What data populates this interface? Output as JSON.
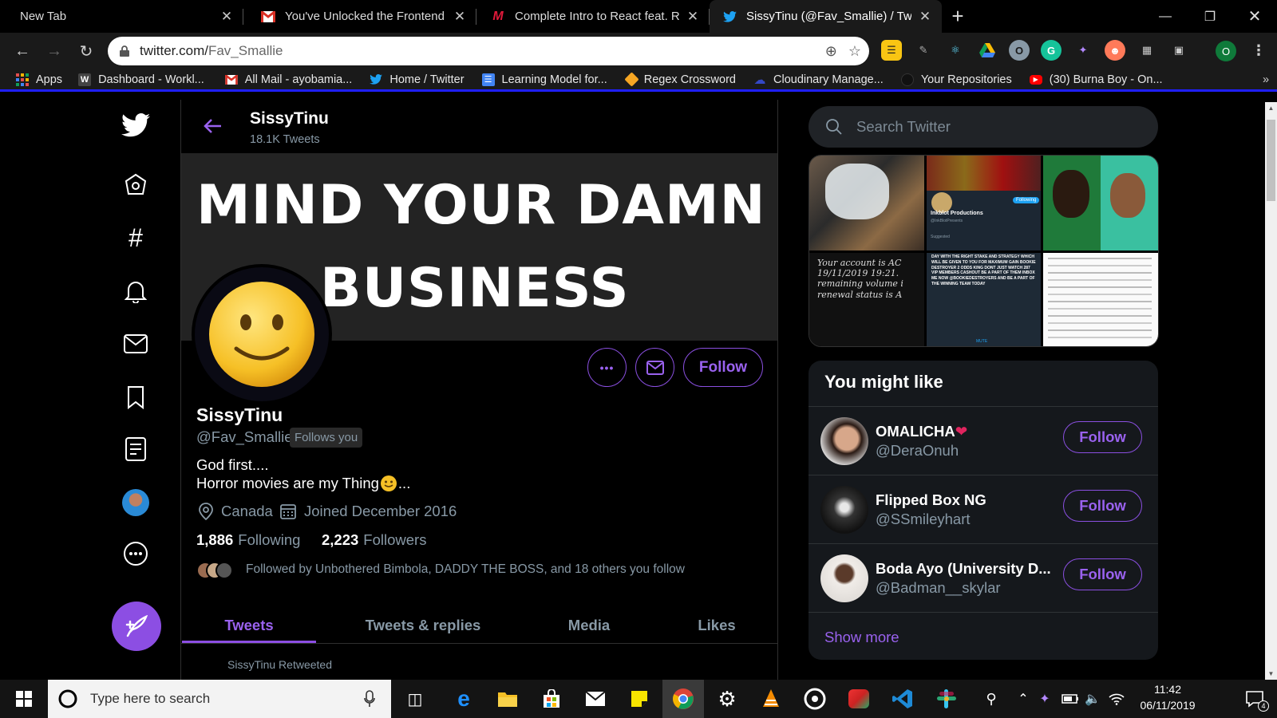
{
  "browser": {
    "tabs": [
      {
        "label": "New Tab",
        "icon": "none"
      },
      {
        "label": "You've Unlocked the Frontend M",
        "icon": "gmail-icon"
      },
      {
        "label": "Complete Intro to React feat. Red",
        "icon": "frontend-masters-icon"
      },
      {
        "label": "SissyTinu (@Fav_Smallie) / Twitte",
        "icon": "twitter-icon",
        "active": true
      }
    ],
    "new_tab": "+",
    "url_host": "twitter.com/",
    "url_path": "Fav_Smallie",
    "profile_initial": "O",
    "bookmarks": [
      {
        "label": "Apps",
        "icon": "apps-grid-icon"
      },
      {
        "label": "Dashboard - Workl...",
        "icon": "w-icon"
      },
      {
        "label": "All Mail - ayobamia...",
        "icon": "gmail-icon"
      },
      {
        "label": "Home / Twitter",
        "icon": "twitter-icon"
      },
      {
        "label": "Learning Model for...",
        "icon": "docs-icon"
      },
      {
        "label": "Regex Crossword",
        "icon": "regex-icon"
      },
      {
        "label": "Cloudinary Manage...",
        "icon": "cloudinary-icon"
      },
      {
        "label": "Your Repositories",
        "icon": "github-icon"
      },
      {
        "label": "(30) Burna Boy - On...",
        "icon": "youtube-icon"
      }
    ],
    "bookmarks_more": "»"
  },
  "profile": {
    "header_name": "SissyTinu",
    "tweet_count": "18.1K Tweets",
    "banner_line1": "MIND YOUR DAMN",
    "banner_line2": "BUSINESS",
    "follow_button": "Follow",
    "more_button": "•••",
    "name": "SissyTinu",
    "handle": "@Fav_Smallie",
    "follows_you": "Follows you",
    "bio_line1": "God first....",
    "bio_line2": "Horror movies are my Thing",
    "bio_line2_end": "...",
    "location": "Canada",
    "joined": "Joined December 2016",
    "following_count": "1,886",
    "following_label": "Following",
    "followers_count": "2,223",
    "followers_label": "Followers",
    "followed_by": "Followed by Unbothered Bimbola, DADDY THE BOSS, and 18 others you follow",
    "tabs": [
      "Tweets",
      "Tweets & replies",
      "Media",
      "Likes"
    ],
    "retweeted_hint": "SissyTinu Retweeted"
  },
  "banner_colors": {
    "accent": "#8c4ee3",
    "link": "#9a62ef"
  },
  "search": {
    "placeholder": "Search Twitter"
  },
  "media_grid": {
    "texts": {
      "netflix_page": "Inkblot Productions",
      "netflix_sub": "@InkBlotPresents",
      "netflix_follow": "Following",
      "netflix_suggest": "Suggested",
      "account_text": "Your account is AC 19/11/2019 19:21. remaining volume i renewal status is A",
      "betting_text": "DAY WITH THE RIGHT STAKE AND STRATEGY WHICH WILL BE GIVEN TO YOU FOR MAXIMUM GAIN BOOKIE DESTROYER 2 ODDS KING DONT JUST WATCH 287 VIP MEMBERS CASHOUT BE A PART OF THEM INBOX ME NOW @BOOKIEDESTROYERS AND BE A PART OF THE WINNING TEAM TODAY",
      "betting_mute": "MUTE"
    }
  },
  "who_to_follow": {
    "title": "You might like",
    "users": [
      {
        "name": "OMALICHA",
        "heart": "❤",
        "handle": "@DeraOnuh",
        "button": "Follow"
      },
      {
        "name": "Flipped Box NG",
        "heart": "",
        "handle": "@SSmileyhart",
        "button": "Follow"
      },
      {
        "name": "Boda Ayo (University D...",
        "heart": "",
        "handle": "@Badman__skylar",
        "button": "Follow"
      }
    ],
    "show_more": "Show more"
  },
  "taskbar": {
    "search_placeholder": "Type here to search",
    "time": "11:42",
    "date": "06/11/2019",
    "notifications": "4"
  }
}
